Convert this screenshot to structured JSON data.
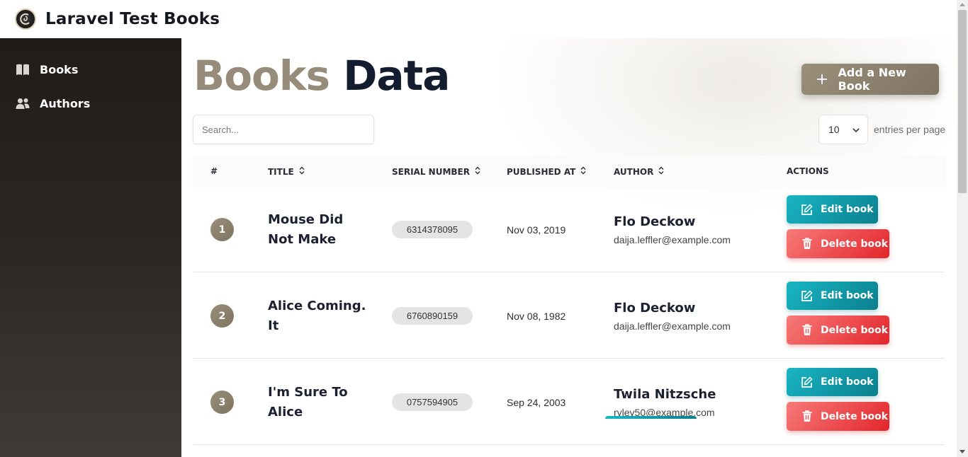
{
  "app": {
    "title": "Laravel Test Books",
    "logo_icon": "app-logo-icon"
  },
  "sidebar": {
    "items": [
      {
        "label": "Books",
        "icon": "book-icon"
      },
      {
        "label": "Authors",
        "icon": "users-icon"
      }
    ]
  },
  "page": {
    "title_part1": "Books",
    "title_part2": "Data",
    "add_button_label": "Add a New Book",
    "add_button_icon": "plus-icon",
    "search_placeholder": "Search...",
    "per_page_value": "10",
    "per_page_label": "entries per page"
  },
  "table": {
    "columns": [
      "#",
      "TITLE",
      "SERIAL NUMBER",
      "PUBLISHED AT",
      "AUTHOR",
      "ACTIONS"
    ],
    "edit_label": "Edit book",
    "delete_label": "Delete book",
    "rows": [
      {
        "num": "1",
        "title": "Mouse Did Not Make",
        "serial": "6314378095",
        "published": "Nov 03, 2019",
        "author": "Flo Deckow",
        "email": "daija.leffler@example.com"
      },
      {
        "num": "2",
        "title": "Alice Coming. It",
        "serial": "6760890159",
        "published": "Nov 08, 1982",
        "author": "Flo Deckow",
        "email": "daija.leffler@example.com"
      },
      {
        "num": "3",
        "title": "I'm Sure To Alice",
        "serial": "0757594905",
        "published": "Sep 24, 2003",
        "author": "Twila Nitzsche",
        "email": "ryley50@example.com"
      }
    ]
  },
  "colors": {
    "accent_gold": "#978c79",
    "edit_teal": "#0b7f8e",
    "delete_red": "#e3262b",
    "sidebar_dark": "#221c18"
  }
}
